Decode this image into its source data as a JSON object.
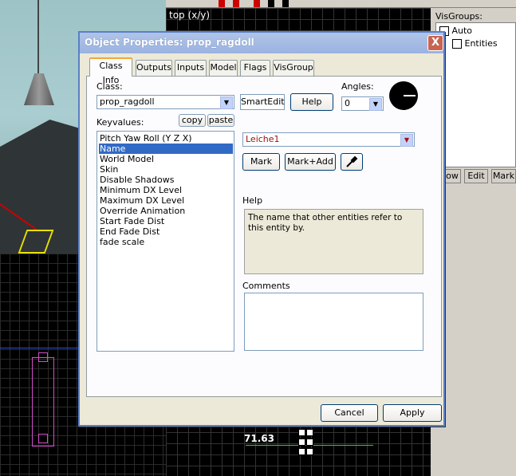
{
  "background": {
    "top_view_label": "top (x/y)",
    "measure_label": "71.63",
    "visgroups": {
      "title": "VisGroups:",
      "items": [
        {
          "label": "Auto"
        },
        {
          "label": "Entities"
        }
      ]
    },
    "right_buttons": {
      "show_label": "ow",
      "edit_label": "Edit",
      "mark_label": "Mark"
    }
  },
  "dialog": {
    "title": "Object Properties: prop_ragdoll",
    "close_glyph": "X",
    "tabs": [
      {
        "label": "Class Info",
        "active": true
      },
      {
        "label": "Outputs"
      },
      {
        "label": "Inputs"
      },
      {
        "label": "Model"
      },
      {
        "label": "Flags"
      },
      {
        "label": "VisGroup"
      }
    ],
    "class_label": "Class:",
    "class_value": "prop_ragdoll",
    "smartedit_label": "SmartEdit",
    "help_button_label": "Help",
    "angles_label": "Angles:",
    "angles_value": "0",
    "keyvalues_label": "Keyvalues:",
    "copy_label": "copy",
    "paste_label": "paste",
    "keyvalues": [
      {
        "name": "Pitch Yaw Roll (Y Z X)"
      },
      {
        "name": "Name",
        "selected": true
      },
      {
        "name": "World Model"
      },
      {
        "name": "Skin"
      },
      {
        "name": "Disable Shadows"
      },
      {
        "name": "Minimum DX Level"
      },
      {
        "name": "Maximum DX Level"
      },
      {
        "name": "Override Animation"
      },
      {
        "name": "Start Fade Dist"
      },
      {
        "name": "End Fade Dist"
      },
      {
        "name": "fade scale"
      }
    ],
    "value_field": "Leiche1",
    "mark_label": "Mark",
    "mark_add_label": "Mark+Add",
    "help_section_label": "Help",
    "help_text": "The name that other entities refer to this entity by.",
    "comments_label": "Comments",
    "comments_value": "",
    "cancel_label": "Cancel",
    "apply_label": "Apply",
    "colors": {
      "selection": "#316ac5",
      "title_bar": "#9ab3e0",
      "close_button": "#c86450",
      "value_text": "#a01010"
    }
  }
}
